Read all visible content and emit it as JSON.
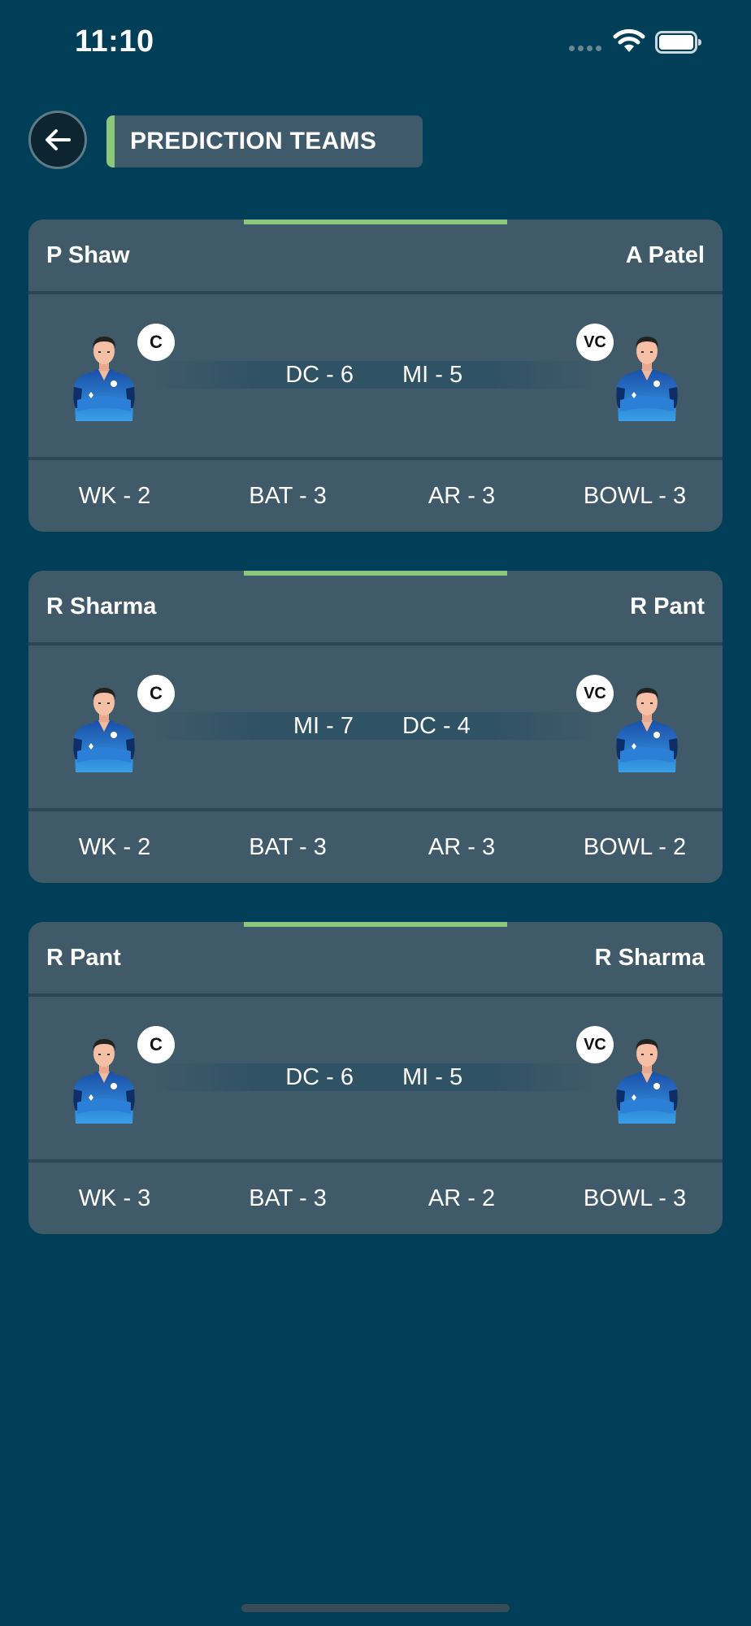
{
  "status": {
    "time": "11:10"
  },
  "header": {
    "title": "PREDICTION TEAMS"
  },
  "teams": [
    {
      "captain": "P Shaw",
      "vice_captain": "A Patel",
      "captain_badge": "C",
      "vice_badge": "VC",
      "team_left": "DC - 6",
      "team_right": "MI - 5",
      "wk": "WK - 2",
      "bat": "BAT - 3",
      "ar": "AR - 3",
      "bowl": "BOWL - 3"
    },
    {
      "captain": "R Sharma",
      "vice_captain": "R Pant",
      "captain_badge": "C",
      "vice_badge": "VC",
      "team_left": "MI - 7",
      "team_right": "DC - 4",
      "wk": "WK - 2",
      "bat": "BAT - 3",
      "ar": "AR - 3",
      "bowl": "BOWL - 2"
    },
    {
      "captain": "R Pant",
      "vice_captain": "R Sharma",
      "captain_badge": "C",
      "vice_badge": "VC",
      "team_left": "DC - 6",
      "team_right": "MI - 5",
      "wk": "WK - 3",
      "bat": "BAT - 3",
      "ar": "AR - 2",
      "bowl": "BOWL - 3"
    }
  ],
  "icons": {
    "back": "arrow-left-icon",
    "wifi": "wifi-icon",
    "battery": "battery-icon",
    "player": "player-avatar-icon"
  },
  "colors": {
    "background": "#003f57",
    "card": "#405a69",
    "accent": "#8dc77c"
  }
}
